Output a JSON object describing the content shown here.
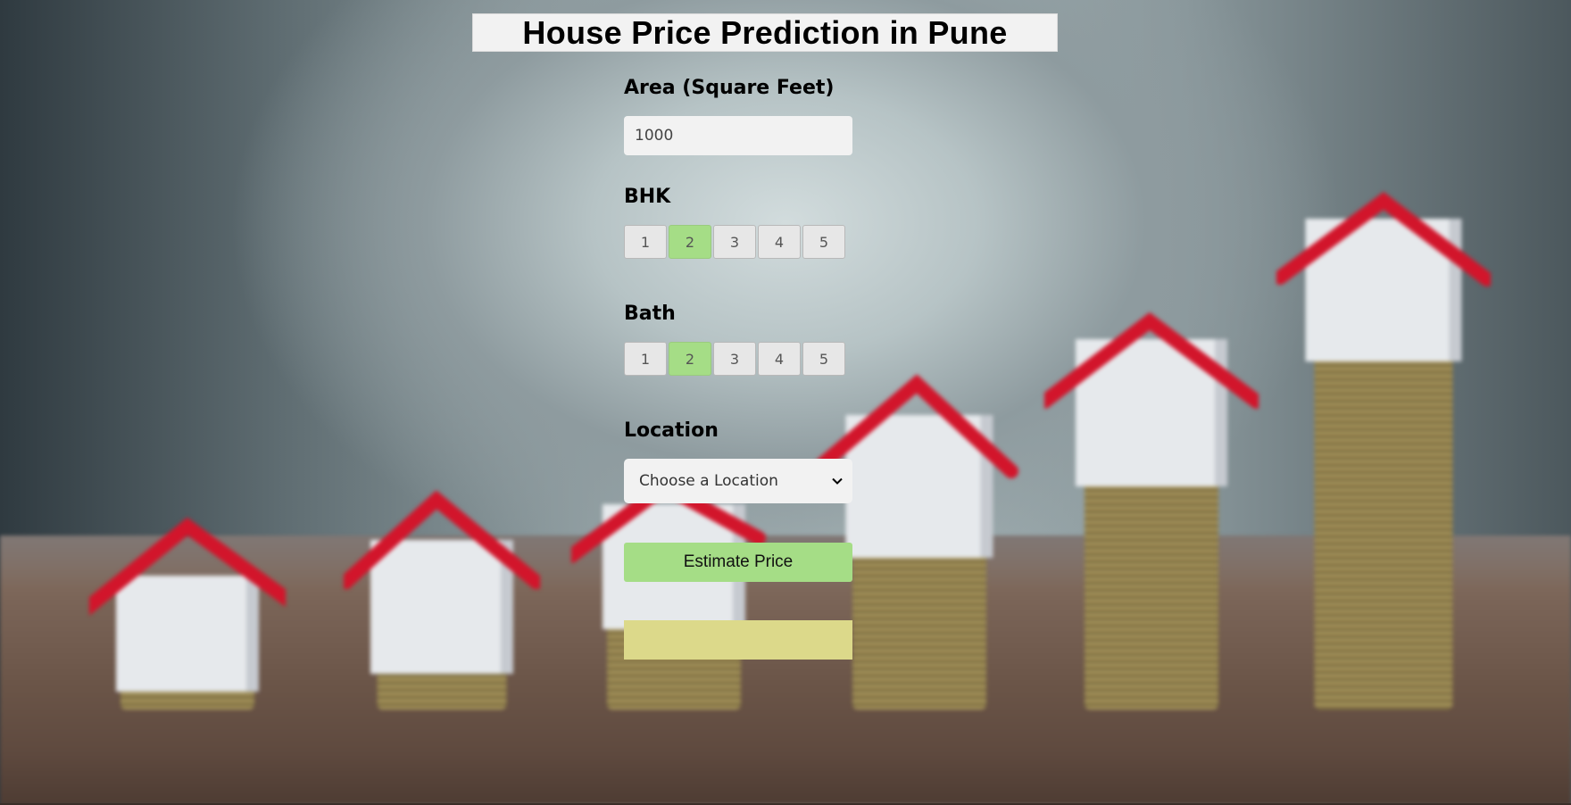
{
  "header": {
    "title": "House Price Prediction in Pune"
  },
  "form": {
    "area": {
      "label": "Area (Square Feet)",
      "value": "1000"
    },
    "bhk": {
      "label": "BHK",
      "options": [
        "1",
        "2",
        "3",
        "4",
        "5"
      ],
      "selected": "2"
    },
    "bath": {
      "label": "Bath",
      "options": [
        "1",
        "2",
        "3",
        "4",
        "5"
      ],
      "selected": "2"
    },
    "location": {
      "label": "Location",
      "selected_text": "Choose a Location"
    },
    "estimate_button": "Estimate Price",
    "result_text": ""
  },
  "background": {
    "description_icon": "houses-on-coin-stacks-image"
  },
  "colors": {
    "accent_green": "#a5dd86",
    "result_yellow": "#dcd98a",
    "field_gray": "#f2f2f2"
  }
}
